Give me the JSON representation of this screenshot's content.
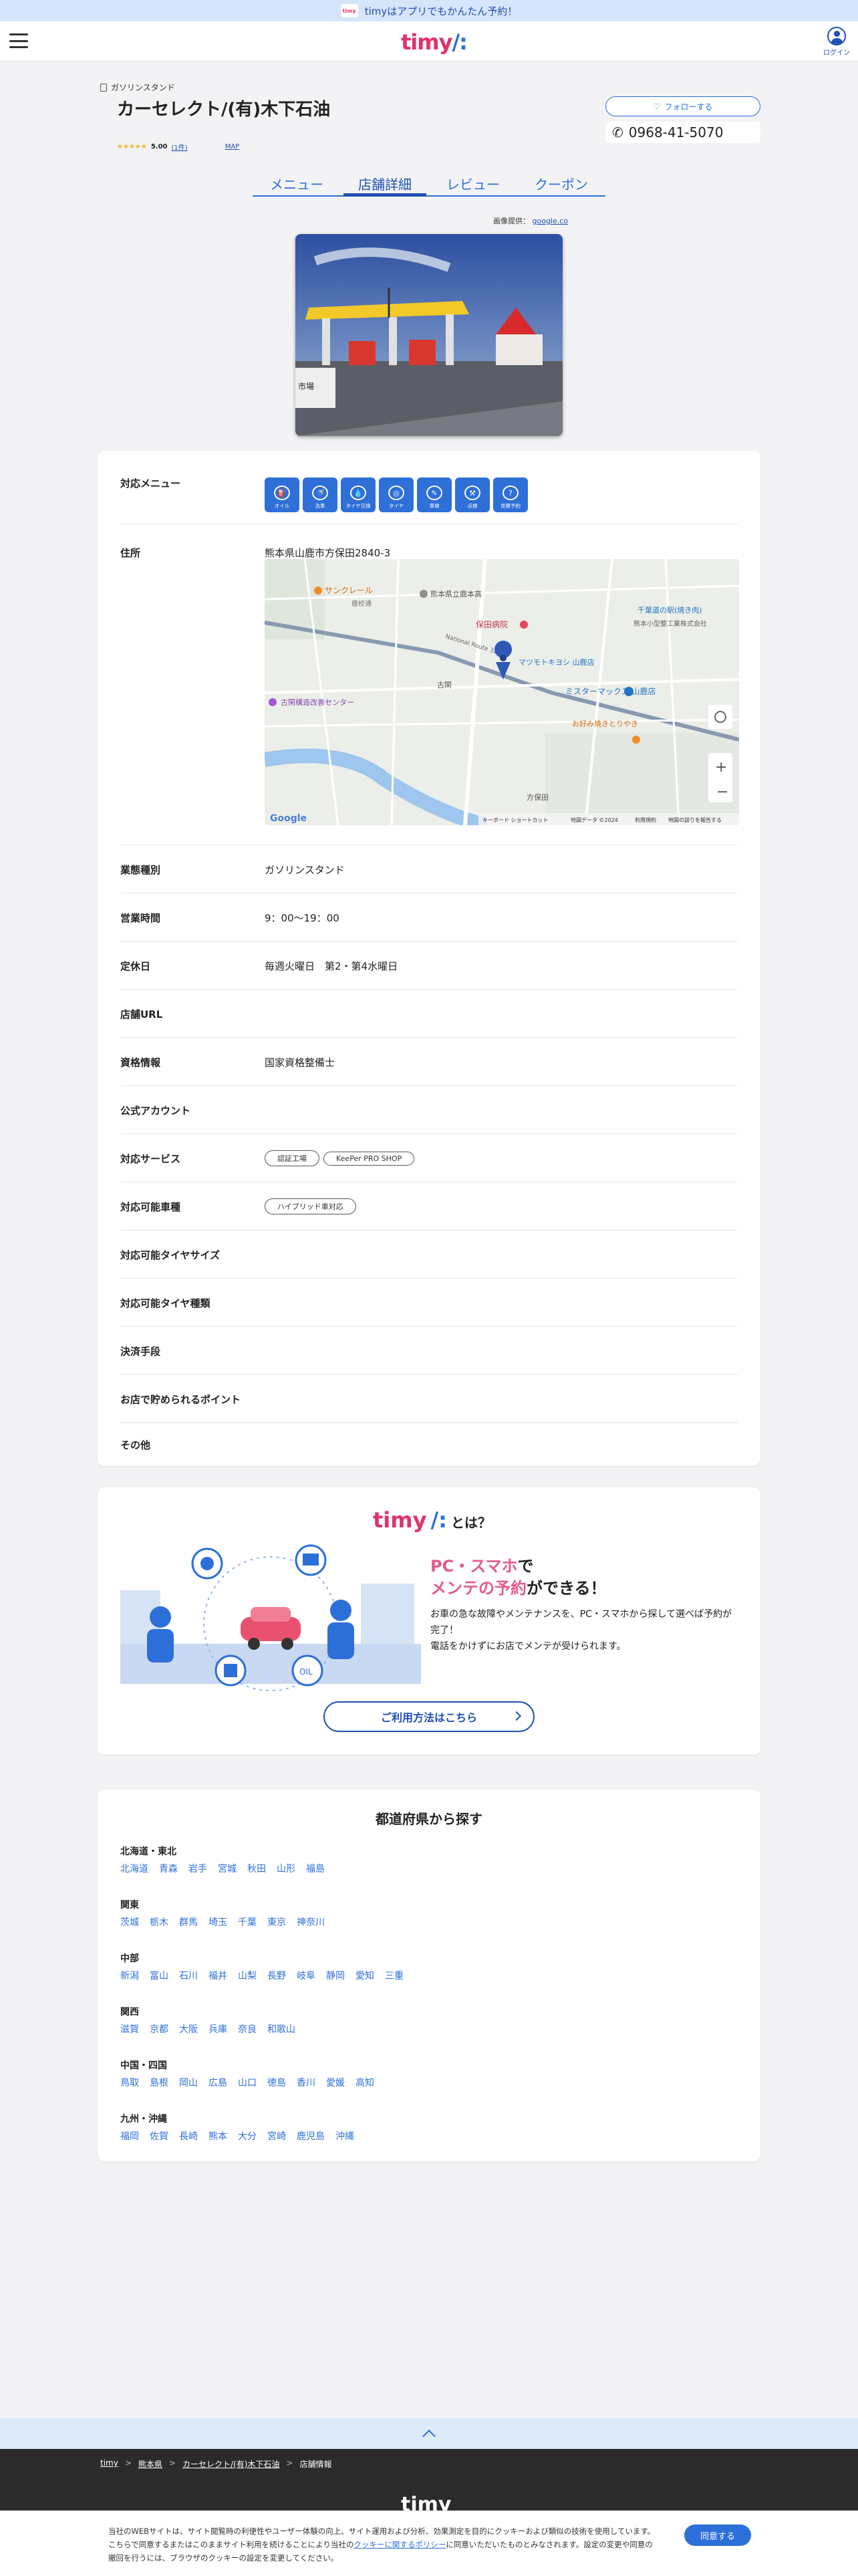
{
  "promo": {
    "badge": "timy",
    "text": "timyはアプリでもかんたん予約！"
  },
  "header": {
    "logo": "timy",
    "login": "ログイン"
  },
  "shop": {
    "category": "ガソリンスタンド",
    "name": "カーセレクト/(有)木下石油",
    "rating_stars": "★★★★★",
    "rating_value": "5.00",
    "rating_count": "(1件)",
    "map_link": "MAP",
    "follow": "フォローする",
    "phone": "0968-41-5070"
  },
  "tabs": [
    "メニュー",
    "店舗詳細",
    "レビュー",
    "クーポン"
  ],
  "photo_credit": {
    "label": "画像提供：",
    "link": "google.co"
  },
  "details": {
    "menu_label": "対応メニュー",
    "menu_icons": [
      {
        "icon": "oil-icon",
        "label": "オイル"
      },
      {
        "icon": "car-wash-icon",
        "label": "洗車"
      },
      {
        "icon": "fluid-icon",
        "label": "タイヤ交換"
      },
      {
        "icon": "tire-icon",
        "label": "タイヤ"
      },
      {
        "icon": "inspection-icon",
        "label": "車検"
      },
      {
        "icon": "repair-icon",
        "label": "点検"
      },
      {
        "icon": "other-icon",
        "label": "見積予約"
      }
    ],
    "address_label": "住所",
    "address": "熊本県山鹿市方保田2840-3",
    "map": {
      "labels": [
        "サンクレール",
        "熊本県立鹿本高",
        "保田病院",
        "マツモトキヨシ 山鹿店",
        "ミスターマックス 山鹿店",
        "古閑構造改善センター",
        "千葉道の駅(焼き肉)",
        "熊本小型整工業株式会社",
        "お好み焼きとりやき",
        "古閑",
        "方保田",
        "鹿校通",
        "National Route 325"
      ],
      "footer": [
        "キーボード ショートカット",
        "地図データ ©2024",
        "利用規約",
        "地図の誤りを報告する"
      ],
      "google": "Google"
    },
    "type_label": "業態種別",
    "type": "ガソリンスタンド",
    "hours_label": "営業時間",
    "hours": "9：00〜19：00",
    "holiday_label": "定休日",
    "holiday": "毎週火曜日　第2・第4水曜日",
    "url_label": "店舗URL",
    "license_label": "資格情報",
    "license": "国家資格整備士",
    "account_label": "公式アカウント",
    "services_label": "対応サービス",
    "services": [
      "認証工場",
      "KeePer PRO SHOP"
    ],
    "vehicles_label": "対応可能車種",
    "vehicles": [
      "ハイブリッド車対応"
    ],
    "tire_size_label": "対応可能タイヤサイズ",
    "tire_type_label": "対応可能タイヤ種類",
    "payment_label": "決済手段",
    "points_label": "お店で貯められるポイント",
    "other_label": "その他"
  },
  "about": {
    "logo": "timy",
    "suffix": "とは？",
    "head1a": "PC・スマホ",
    "head1b": "で",
    "head2a": "メンテの予約",
    "head2b": "ができる！",
    "text": "お車の急な故障やメンテナンスを、PC・スマホから探して選べば予約が完了！\n電話をかけずにお店でメンテが受けられます。",
    "button": "ご利用方法はこちら"
  },
  "prefectures": {
    "title": "都道府県から探す",
    "regions": [
      {
        "name": "北海道・東北",
        "items": [
          "北海道",
          "青森",
          "岩手",
          "宮城",
          "秋田",
          "山形",
          "福島"
        ]
      },
      {
        "name": "関東",
        "items": [
          "茨城",
          "栃木",
          "群馬",
          "埼玉",
          "千葉",
          "東京",
          "神奈川"
        ]
      },
      {
        "name": "中部",
        "items": [
          "新潟",
          "富山",
          "石川",
          "福井",
          "山梨",
          "長野",
          "岐阜",
          "静岡",
          "愛知",
          "三重"
        ]
      },
      {
        "name": "関西",
        "items": [
          "滋賀",
          "京都",
          "大阪",
          "兵庫",
          "奈良",
          "和歌山"
        ]
      },
      {
        "name": "中国・四国",
        "items": [
          "鳥取",
          "島根",
          "岡山",
          "広島",
          "山口",
          "徳島",
          "香川",
          "愛媛",
          "高知"
        ]
      },
      {
        "name": "九州・沖縄",
        "items": [
          "福岡",
          "佐賀",
          "長崎",
          "熊本",
          "大分",
          "宮崎",
          "鹿児島",
          "沖縄"
        ]
      }
    ]
  },
  "breadcrumb": [
    "timy",
    "熊本県",
    "カーセレクト/(有)木下石油",
    "店舗情報"
  ],
  "footer_logo": "timy",
  "cookie": {
    "text_before": "当社のWEBサイトは、サイト閲覧時の利便性やユーザー体験の向上、サイト運用および分析、効果測定を目的にクッキーおよび類似の技術を使用しています。こちらで同意するまたはこのままサイト利用を続けることにより当社の",
    "link": "クッキーに関するポリシー",
    "text_after": "に同意いただいたものとみなされます。設定の変更や同意の撤回を行うには、ブラウザのクッキーの設定を変更してください。",
    "agree": "同意する"
  },
  "colors": {
    "accent": "#2d6fd9",
    "brand_pink": "#e0336a",
    "bg": "#f3f3f5"
  }
}
